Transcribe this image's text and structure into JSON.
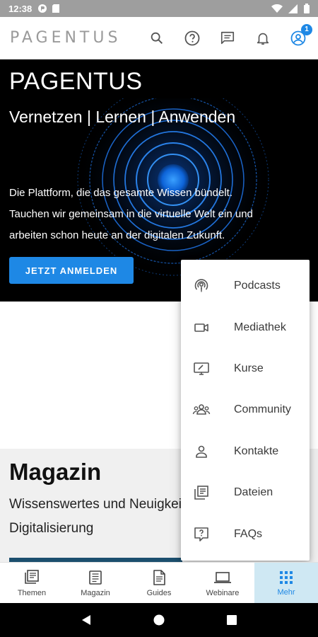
{
  "status_bar": {
    "time": "12:38"
  },
  "app_bar": {
    "logo": "PAGENTUS",
    "notification_badge": "1"
  },
  "hero": {
    "title": "PAGENTUS",
    "subtitle": "Vernetzen | Lernen | Anwenden",
    "text_line1": "Die Plattform, die das gesamte Wissen bündelt.",
    "text_line2": "Tauchen wir gemeinsam in die virtuelle Welt ein und",
    "text_line3": "arbeiten schon heute an der digitalen Zukunft.",
    "button_label": "JETZT ANMELDEN"
  },
  "magazin": {
    "title": "Magazin",
    "subtitle_line1": "Wissenswertes und Neuigkeiten rund um die",
    "subtitle_line2": "Digitalisierung"
  },
  "menu": {
    "items": [
      {
        "label": "Podcasts",
        "icon": "podcast-icon"
      },
      {
        "label": "Mediathek",
        "icon": "video-camera-icon"
      },
      {
        "label": "Kurse",
        "icon": "monitor-icon"
      },
      {
        "label": "Community",
        "icon": "group-icon"
      },
      {
        "label": "Kontakte",
        "icon": "person-icon"
      },
      {
        "label": "Dateien",
        "icon": "files-icon"
      },
      {
        "label": "FAQs",
        "icon": "help-chat-icon"
      }
    ]
  },
  "bottom_nav": {
    "items": [
      {
        "label": "Themen",
        "icon": "book-icon"
      },
      {
        "label": "Magazin",
        "icon": "magazine-icon"
      },
      {
        "label": "Guides",
        "icon": "document-icon"
      },
      {
        "label": "Webinare",
        "icon": "laptop-icon"
      },
      {
        "label": "Mehr",
        "icon": "grid-icon",
        "active": true
      }
    ]
  },
  "colors": {
    "accent": "#1e88e5",
    "hero_bg": "#000000",
    "active_tab_bg": "#cfe8f3"
  }
}
